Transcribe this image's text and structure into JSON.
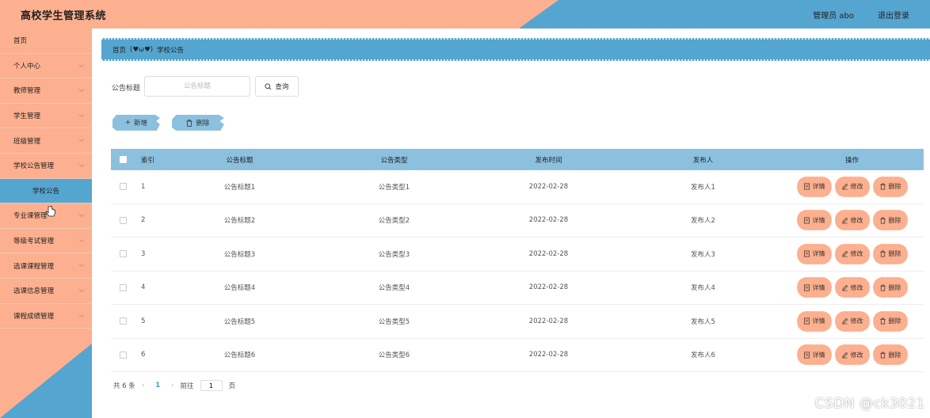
{
  "header": {
    "title": "高校学生管理系统",
    "admin": "管理员 abo",
    "logout": "退出登录"
  },
  "sidebar": {
    "items": [
      {
        "label": "首页",
        "has_arrow": false
      },
      {
        "label": "个人中心",
        "has_arrow": true
      },
      {
        "label": "教师管理",
        "has_arrow": true
      },
      {
        "label": "学生管理",
        "has_arrow": true
      },
      {
        "label": "班级管理",
        "has_arrow": true
      },
      {
        "label": "学校公告管理",
        "has_arrow": true
      },
      {
        "label": "学校公告",
        "has_arrow": false,
        "active": true
      },
      {
        "label": "专业课管理",
        "has_arrow": true
      },
      {
        "label": "等级考试管理",
        "has_arrow": true
      },
      {
        "label": "选课课程管理",
        "has_arrow": true
      },
      {
        "label": "选课信息管理",
        "has_arrow": true
      },
      {
        "label": "课程成绩管理",
        "has_arrow": true
      }
    ]
  },
  "breadcrumb": {
    "home": "首页",
    "face": "(♥ω♥)",
    "current": "学校公告"
  },
  "search": {
    "label": "公告标题",
    "placeholder": "公告标题",
    "button": "查询"
  },
  "actions": {
    "add": "新增",
    "delete": "删除"
  },
  "table": {
    "headers": {
      "index": "索引",
      "title": "公告标题",
      "type": "公告类型",
      "time": "发布时间",
      "publisher": "发布人",
      "ops": "操作"
    },
    "rows": [
      {
        "index": "1",
        "title": "公告标题1",
        "type": "公告类型1",
        "time": "2022-02-28",
        "publisher": "发布人1"
      },
      {
        "index": "2",
        "title": "公告标题2",
        "type": "公告类型2",
        "time": "2022-02-28",
        "publisher": "发布人2"
      },
      {
        "index": "3",
        "title": "公告标题3",
        "type": "公告类型3",
        "time": "2022-02-28",
        "publisher": "发布人3"
      },
      {
        "index": "4",
        "title": "公告标题4",
        "type": "公告类型4",
        "time": "2022-02-28",
        "publisher": "发布人4"
      },
      {
        "index": "5",
        "title": "公告标题5",
        "type": "公告类型5",
        "time": "2022-02-28",
        "publisher": "发布人5"
      },
      {
        "index": "6",
        "title": "公告标题6",
        "type": "公告类型6",
        "time": "2022-02-28",
        "publisher": "发布人6"
      }
    ],
    "row_buttons": {
      "detail": "详情",
      "edit": "修改",
      "delete": "删除"
    }
  },
  "pagination": {
    "total": "共 6 条",
    "current_page": "1",
    "goto_label": "前往",
    "goto_value": "1",
    "page_suffix": "页"
  },
  "watermark": "CSDN @ck3021",
  "colors": {
    "peach": "#fcb08f",
    "blue": "#55a5d1",
    "light_blue": "#8bc1de"
  }
}
